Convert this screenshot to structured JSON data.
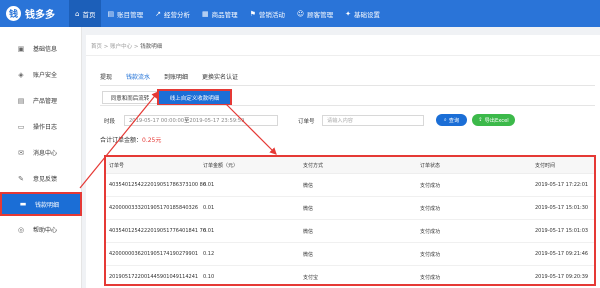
{
  "brand": {
    "logo_glyph": "钱",
    "name": "钱多多"
  },
  "nav": [
    {
      "label": "首页",
      "icon": "home-icon",
      "glyph": "⌂",
      "active": true
    },
    {
      "label": "账目管理",
      "icon": "ledger-icon",
      "glyph": "▤",
      "active": false
    },
    {
      "label": "经营分析",
      "icon": "analytics-icon",
      "glyph": "↗",
      "active": false
    },
    {
      "label": "商品管理",
      "icon": "goods-icon",
      "glyph": "▦",
      "active": false
    },
    {
      "label": "营销活动",
      "icon": "flag-icon",
      "glyph": "⚑",
      "active": false
    },
    {
      "label": "顾客管理",
      "icon": "user-icon",
      "glyph": "☺",
      "active": false
    },
    {
      "label": "基础设置",
      "icon": "settings-icon",
      "glyph": "✦",
      "active": false
    }
  ],
  "sidebar": [
    {
      "label": "基础信息",
      "icon": "info-icon",
      "glyph": "▣",
      "active": false
    },
    {
      "label": "账户安全",
      "icon": "shield-icon",
      "glyph": "◈",
      "active": false
    },
    {
      "label": "产品管理",
      "icon": "product-icon",
      "glyph": "▤",
      "active": false
    },
    {
      "label": "操作日志",
      "icon": "log-icon",
      "glyph": "▭",
      "active": false
    },
    {
      "label": "消息中心",
      "icon": "message-icon",
      "glyph": "✉",
      "active": false
    },
    {
      "label": "意见反馈",
      "icon": "feedback-icon",
      "glyph": "✎",
      "active": false
    },
    {
      "label": "钱款明细",
      "icon": "wallet-icon",
      "glyph": "▬",
      "active": true
    },
    {
      "label": "帮助中心",
      "icon": "help-icon",
      "glyph": "◎",
      "active": false
    }
  ],
  "breadcrumb": {
    "home": "首页",
    "sep1": ">",
    "account": "账户中心",
    "sep2": ">",
    "current": "钱款明细"
  },
  "tabs": [
    {
      "label": "提现",
      "active": false
    },
    {
      "label": "钱款流水",
      "active": true
    },
    {
      "label": "到账明细",
      "active": false
    },
    {
      "label": "更换实名认证",
      "active": false
    }
  ],
  "subtabs": {
    "first": "同意和而后流转",
    "second": "线上自定义收款明细"
  },
  "filters": {
    "time_label": "时段",
    "date_start": "2019-05-17 00:00:00",
    "date_sep": "至",
    "date_end": "2019-05-17 23:59:59",
    "order_label": "订单号",
    "order_placeholder": "请输入内容",
    "query_button": "查询",
    "export_button": "导出Excel"
  },
  "summary": {
    "label": "合计订单金额：",
    "amount": "0.25元"
  },
  "table": {
    "headers": [
      "订单号",
      "订单金额（元）",
      "支付方式",
      "订单状态",
      "支付时间"
    ],
    "rows": [
      [
        "4035401254222019051786373100 86",
        "0.01",
        "微信",
        "支付成功",
        "2019-05-17 17:22:01"
      ],
      [
        "4200000333201905170185840326",
        "0.01",
        "微信",
        "支付成功",
        "2019-05-17 15:01:30"
      ],
      [
        "4035401254222019051776401841 76",
        "0.01",
        "微信",
        "支付成功",
        "2019-05-17 15:01:03"
      ],
      [
        "4200000036201905174190279901",
        "0.12",
        "微信",
        "支付成功",
        "2019-05-17 09:21:46"
      ],
      [
        "2019051722001445901049114241",
        "0.10",
        "支付宝",
        "支付成功",
        "2019-05-17 09:20:39"
      ]
    ]
  },
  "colors": {
    "primary": "#1b6ed6",
    "topbar": "#2a74d8",
    "highlight": "#e53935",
    "export": "#3cb94a"
  }
}
